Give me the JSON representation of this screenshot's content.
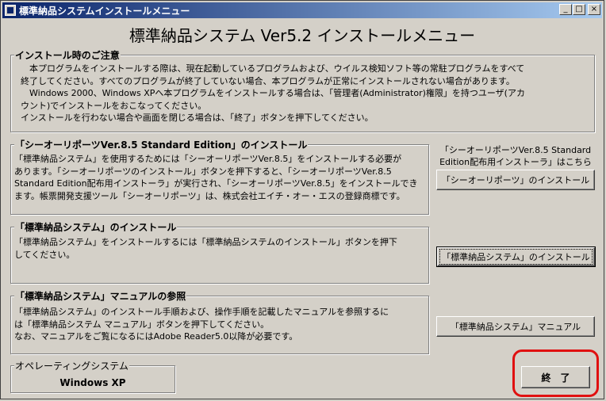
{
  "window": {
    "title": "標準納品システムインストールメニュー",
    "minimize": "_",
    "maximize": "□",
    "close": "×"
  },
  "main_title": "標準納品システム Ver5.2 インストールメニュー",
  "notice": {
    "title": "インストール時のご注意",
    "lines": [
      "　本プログラムをインストールする際は、現在起動しているプログラムおよび、ウイルス検知ソフト等の常駐プログラムをすべて",
      "終了してください。すべてのプログラムが終了していない場合、本プログラムが正常にインストールされない場合があります。",
      "　Windows 2000、Windows XPへ本プログラムをインストールする場合は、「管理者(Administrator)権限」を持つユーザ(アカ",
      "ウント)でインストールをおこなってください。",
      "インストールを行わない場合や画面を閉じる場合は、「終了」ボタンを押下してください。"
    ]
  },
  "co_reports": {
    "title": "「シーオーリポーツVer.8.5 Standard Edition」のインストール",
    "lines": [
      "「標準納品システム」を使用するためには「シーオーリポーツVer.8.5」をインストールする必要が",
      "あります。「シーオーリポーツのインストール」ボタンを押下すると、「シーオーリポーツVer.8.5",
      "Standard Edition配布用インストーラ」が実行され、「シーオーリポーツVer.8.5」をインストールでき",
      "ます。帳票開発支援ツール「シーオーリポーツ」は、株式会社エイチ・オー・エスの登録商標です。"
    ],
    "side_note_line1": "「シーオーリポーツVer.8.5 Standard",
    "side_note_line2": "Edition配布用インストーラ」はこちら",
    "button": "「シーオーリポーツ」のインストール"
  },
  "system_install": {
    "title": "「標準納品システム」のインストール",
    "lines": [
      "「標準納品システム」をインストールするには「標準納品システムのインストール」ボタンを押下",
      "してください。"
    ],
    "button": "「標準納品システム」のインストール"
  },
  "manual": {
    "title": "「標準納品システム」マニュアルの参照",
    "lines": [
      "「標準納品システム」のインストール手順および、操作手順を記載したマニュアルを参照するに",
      "は「標準納品システム マニュアル」ボタンを押下してください。",
      "なお、マニュアルをご覧になるにはAdobe Reader5.0以降が必要です。"
    ],
    "button": "「標準納品システム」マニュアル"
  },
  "os": {
    "title": "オペレーティングシステム",
    "value": "Windows XP"
  },
  "exit_button": "終　了",
  "colors": {
    "title_bar_start": "#0a246a",
    "title_bar_end": "#a6caf0",
    "face": "#d4d0c8",
    "highlight": "#e01010"
  }
}
